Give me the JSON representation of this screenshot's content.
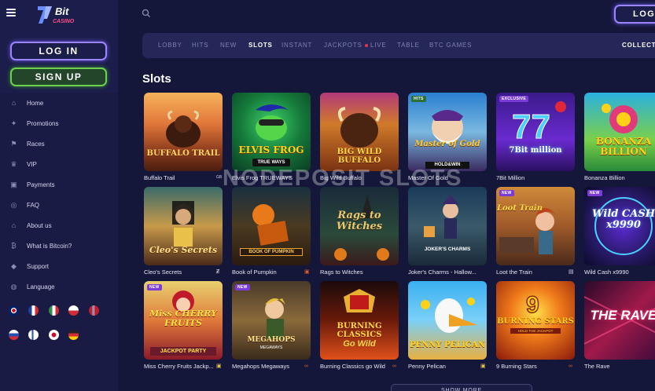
{
  "brand": {
    "logo_text": "Bit",
    "logo_sub": "CASINO"
  },
  "auth": {
    "login_label": "LOG IN",
    "signup_label": "SIGN UP",
    "top_login_label": "LOG"
  },
  "menu": [
    {
      "label": "Home",
      "icon": "home-icon"
    },
    {
      "label": "Promotions",
      "icon": "gift-icon"
    },
    {
      "label": "Races",
      "icon": "flag-icon"
    },
    {
      "label": "VIP",
      "icon": "crown-icon"
    },
    {
      "label": "Payments",
      "icon": "wallet-icon"
    },
    {
      "label": "FAQ",
      "icon": "lifebuoy-icon"
    },
    {
      "label": "About us",
      "icon": "house-icon"
    },
    {
      "label": "What is Bitcoin?",
      "icon": "bitcoin-icon"
    },
    {
      "label": "Support",
      "icon": "shield-icon"
    },
    {
      "label": "Language",
      "icon": "globe-icon"
    }
  ],
  "tabs": [
    {
      "label": "LOBBY"
    },
    {
      "label": "HITS"
    },
    {
      "label": "NEW"
    },
    {
      "label": "SLOTS"
    },
    {
      "label": "INSTANT"
    },
    {
      "label": "JACKPOTS"
    },
    {
      "label": "LIVE"
    },
    {
      "label": "TABLE"
    },
    {
      "label": "BTC GAMES"
    },
    {
      "label": "COLLECTE"
    }
  ],
  "section_title": "Slots",
  "watermark": "NODEPOSIT SLOTS",
  "games": [
    {
      "name": "Buffalo Trail",
      "art": "BUFFALO TRAIL",
      "badge": "",
      "provider_icon": "GB"
    },
    {
      "name": "Elvis Frog TRUEWAYS",
      "art": "ELVIS FROG",
      "badge": "",
      "provider_icon": ""
    },
    {
      "name": "Big Wild Buffalo",
      "art": "BIG WILD BUFFALO",
      "badge": "",
      "provider_icon": ""
    },
    {
      "name": "Master Of Gold",
      "art": "Master of Gold",
      "badge": "HITS",
      "provider_icon": ""
    },
    {
      "name": "7Bit Million",
      "art": "7Bit million",
      "badge": "EXCLUSIVE",
      "provider_icon": ""
    },
    {
      "name": "Bonanza Billion",
      "art": "BONANZA BILLION",
      "badge": "",
      "provider_icon": ""
    },
    {
      "name": "Cleo's Secrets",
      "art": "Cleo's Secrets",
      "badge": "",
      "provider_icon": ""
    },
    {
      "name": "Book of Pumpkin",
      "art": "BOOK OF PUMPKIN",
      "badge": "",
      "provider_icon": ""
    },
    {
      "name": "Rags to Witches",
      "art": "Rags to Witches",
      "badge": "",
      "provider_icon": ""
    },
    {
      "name": "Joker's Charms - Hallow...",
      "art": "JOKER'S CHARMS",
      "badge": "",
      "provider_icon": ""
    },
    {
      "name": "Loot the Train",
      "art": "Loot Train",
      "badge": "NEW",
      "provider_icon": ""
    },
    {
      "name": "Wild Cash x9990",
      "art": "Wild CASH x9990",
      "badge": "NEW",
      "provider_icon": ""
    },
    {
      "name": "Miss Cherry Fruits Jackp...",
      "art": "Miss CHERRY FRUITS",
      "badge": "NEW",
      "provider_icon": ""
    },
    {
      "name": "Megahops Megaways",
      "art": "MEGAHOPS",
      "badge": "NEW",
      "provider_icon": ""
    },
    {
      "name": "Burning Classics go Wild",
      "art": "BURNING CLASSICS",
      "badge": "",
      "provider_icon": ""
    },
    {
      "name": "Penny Pelican",
      "art": "PENNY PELICAN",
      "badge": "",
      "provider_icon": ""
    },
    {
      "name": "9 Burning Stars",
      "art": "BURNING STARS",
      "badge": "",
      "provider_icon": ""
    },
    {
      "name": "The Rave",
      "art": "THE RAVE",
      "badge": "",
      "provider_icon": ""
    }
  ],
  "show_more_label": "SHOW MORE",
  "flags": [
    "uk",
    "fr",
    "it",
    "pl",
    "no",
    "ru",
    "fi",
    "jp",
    "de"
  ],
  "colors": {
    "accent_purple": "#9b84ff",
    "accent_green": "#6ed04f",
    "bg": "#14163a",
    "sidebar": "#191b45"
  }
}
